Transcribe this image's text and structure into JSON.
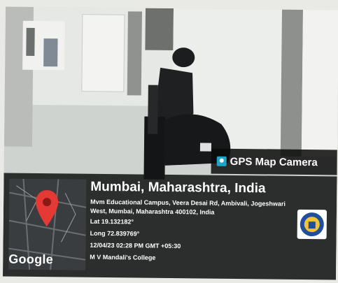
{
  "badge": {
    "text": "GPS Map Camera",
    "icon": "gps-map-camera-icon"
  },
  "map": {
    "provider": "Google",
    "pin_color": "#e53935"
  },
  "location": {
    "city": "Mumbai, Maharashtra, India",
    "address": "Mvm Educational Campus, Veera Desai Rd, Ambivali, Jogeshwari West, Mumbai, Maharashtra 400102, India",
    "lat": "Lat 19.132182°",
    "long": "Long 72.839769°",
    "datetime": "12/04/23 02:28 PM GMT +05:30",
    "note": "M V Mandali's College"
  },
  "logo": {
    "icon": "college-logo-icon"
  },
  "colors": {
    "panel": "#161616",
    "badge_accent": "#1fa3c7"
  }
}
